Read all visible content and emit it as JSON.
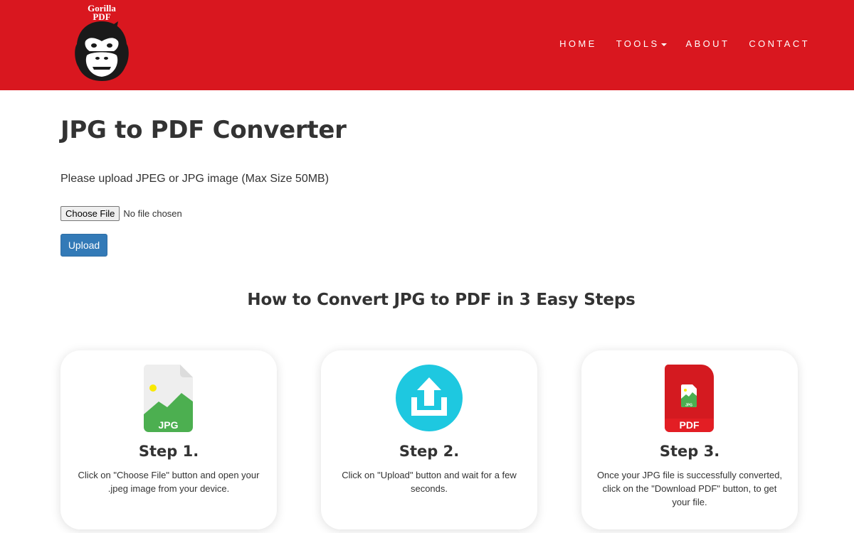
{
  "header": {
    "logo_line1": "Gorilla",
    "logo_line2": "PDF",
    "nav": {
      "home": "HOME",
      "tools": "TOOLS",
      "about": "ABOUT",
      "contact": "CONTACT"
    }
  },
  "main": {
    "title": "JPG to PDF Converter",
    "upload_hint": "Please upload JPEG or JPG image (Max Size 50MB)",
    "file_input": {
      "button_label": "Choose File",
      "status": "No file chosen"
    },
    "upload_button": "Upload"
  },
  "steps": {
    "title": "How to Convert JPG to PDF in 3 Easy Steps",
    "items": [
      {
        "icon": "jpg-file-icon",
        "icon_label": "JPG",
        "title": "Step 1.",
        "description": "Click on \"Choose File\" button and open your .jpeg image from your device."
      },
      {
        "icon": "upload-icon",
        "title": "Step 2.",
        "description": "Click on \"Upload\" button and wait for a few seconds."
      },
      {
        "icon": "pdf-file-icon",
        "icon_label": "PDF",
        "icon_sublabel": "JPG",
        "title": "Step 3.",
        "description": "Once your JPG file is successfully converted, click on the \"Download PDF\" button, to get your file."
      }
    ]
  },
  "colors": {
    "header_bg": "#d9171f",
    "upload_button": "#337ab7",
    "jpg_green": "#4caf50",
    "upload_cyan": "#1ec8e0",
    "pdf_red": "#e31e24"
  }
}
